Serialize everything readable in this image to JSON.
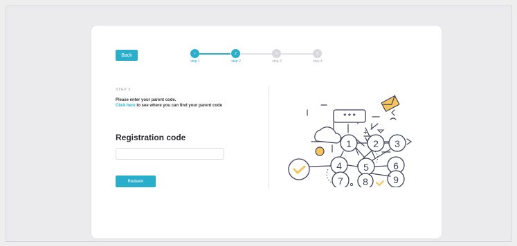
{
  "header": {
    "back_label": "Back"
  },
  "stepper": {
    "steps": [
      {
        "label": "step 1",
        "badge": "✓",
        "state": "done"
      },
      {
        "label": "step 2",
        "badge": "2",
        "state": "active"
      },
      {
        "label": "step 3",
        "badge": "3",
        "state": "todo"
      },
      {
        "label": "step 4",
        "badge": "4",
        "state": "todo"
      }
    ]
  },
  "form": {
    "step_tag": "STEP 2",
    "prompt_text": "Please enter your parent code.",
    "link_text": "Click here",
    "link_suffix": " to see where you can find your parent code",
    "title": "Registration code",
    "code_value": "",
    "code_placeholder": "",
    "redeem_label": "Redeem"
  },
  "illustration": {
    "password_mask": "* * *",
    "plus": "+",
    "numbers": [
      "1",
      "2",
      "3",
      "4",
      "5",
      "6",
      "7",
      "8",
      "9"
    ]
  },
  "colors": {
    "accent": "#2baecb",
    "ink": "#3e4158",
    "highlight": "#f5c45e"
  }
}
